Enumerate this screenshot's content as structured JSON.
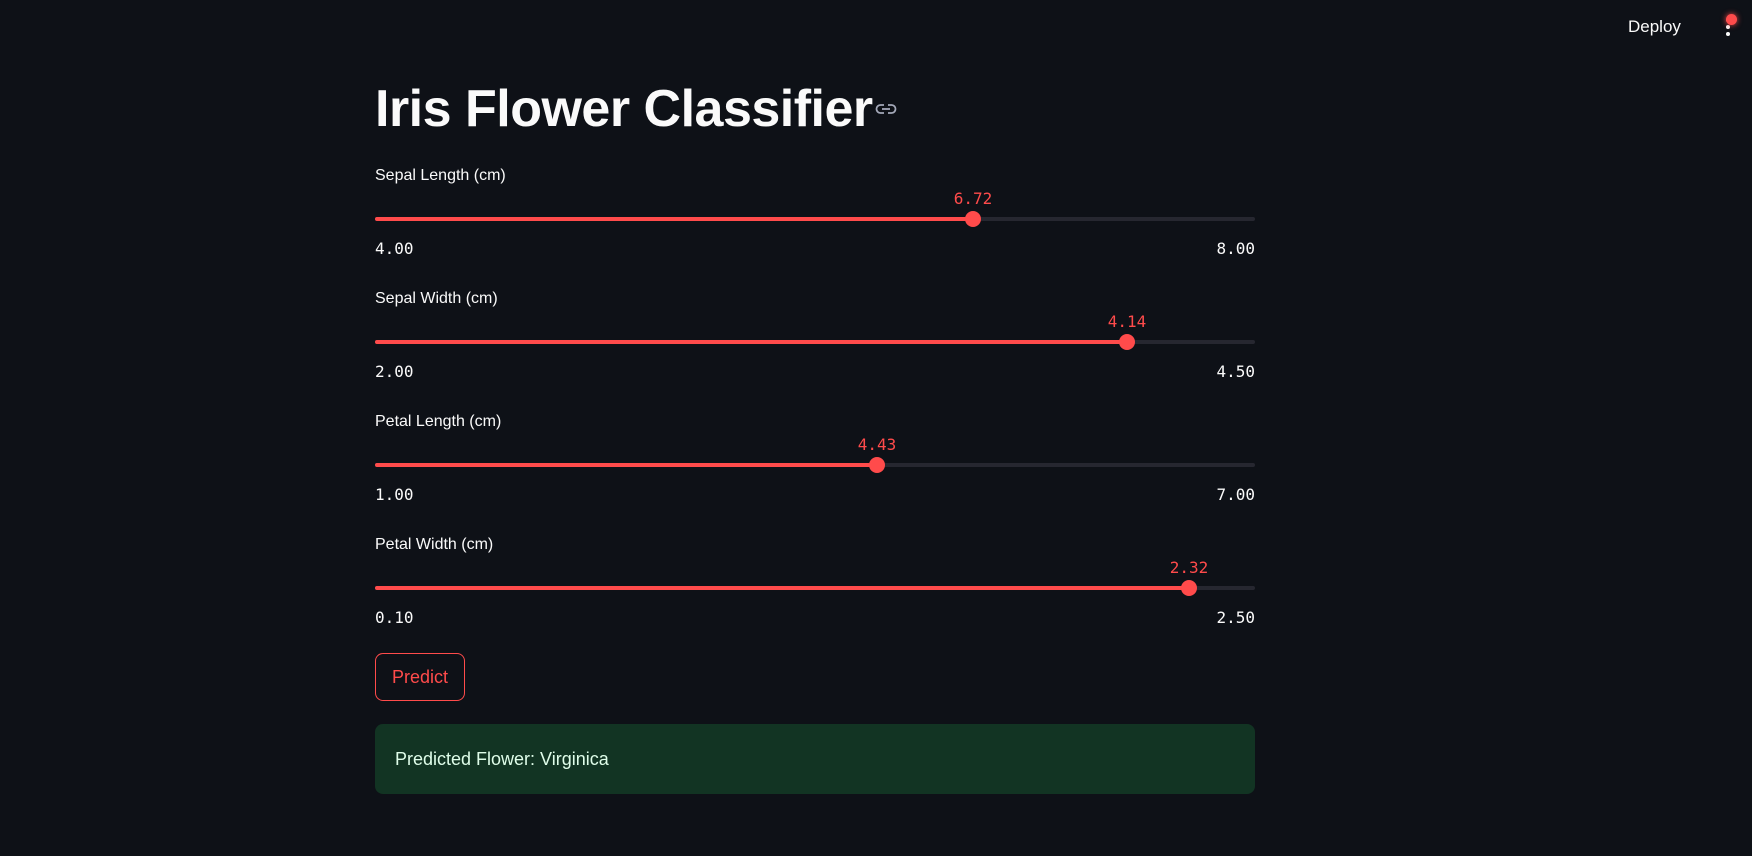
{
  "header": {
    "deploy_label": "Deploy",
    "menu_icon": "kebab-menu-icon",
    "status_color": "#ff4b4b"
  },
  "page": {
    "title": "Iris Flower Classifier",
    "title_link_icon": "link-icon"
  },
  "sliders": [
    {
      "label": "Sepal Length (cm)",
      "value": "6.72",
      "min": "4.00",
      "max": "8.00"
    },
    {
      "label": "Sepal Width (cm)",
      "value": "4.14",
      "min": "2.00",
      "max": "4.50"
    },
    {
      "label": "Petal Length (cm)",
      "value": "4.43",
      "min": "1.00",
      "max": "7.00"
    },
    {
      "label": "Petal Width (cm)",
      "value": "2.32",
      "min": "0.10",
      "max": "2.50"
    }
  ],
  "predict_button": {
    "label": "Predict"
  },
  "result": {
    "text": "Predicted Flower: Virginica"
  },
  "colors": {
    "background": "#0e1117",
    "accent": "#ff4b4b",
    "track": "#262730",
    "success_bg": "#1a3a2a",
    "success_text": "#dffde9"
  }
}
